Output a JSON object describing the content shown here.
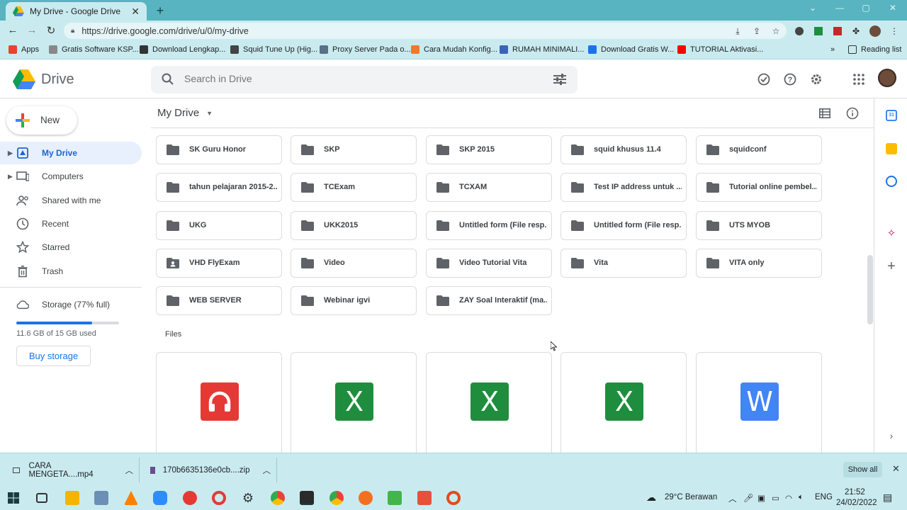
{
  "browser": {
    "tab_title": "My Drive - Google Drive",
    "url": "https://drive.google.com/drive/u/0/my-drive",
    "bookmarks": [
      {
        "label": "Apps",
        "color": "#e94235"
      },
      {
        "label": "Gratis Software KSP...",
        "color": "#888888"
      },
      {
        "label": "Download Lengkap...",
        "color": "#333333"
      },
      {
        "label": "Squid Tune Up (Hig...",
        "color": "#444444"
      },
      {
        "label": "Proxy Server Pada o...",
        "color": "#5b6f86"
      },
      {
        "label": "Cara Mudah Konfig...",
        "color": "#f0792b"
      },
      {
        "label": "RUMAH MINIMALI...",
        "color": "#3b64b8"
      },
      {
        "label": "Download Gratis W...",
        "color": "#1a73e8"
      },
      {
        "label": "TUTORIAL Aktivasi...",
        "color": "#ff0000"
      }
    ],
    "reading_list": "Reading list"
  },
  "drive": {
    "app_name": "Drive",
    "search_placeholder": "Search in Drive",
    "new_label": "New",
    "nav": [
      {
        "label": "My Drive",
        "active": true,
        "caret": true,
        "icon": "my-drive-icon"
      },
      {
        "label": "Computers",
        "active": false,
        "caret": true,
        "icon": "computers-icon"
      },
      {
        "label": "Shared with me",
        "active": false,
        "caret": false,
        "icon": "shared-icon"
      },
      {
        "label": "Recent",
        "active": false,
        "caret": false,
        "icon": "clock-icon"
      },
      {
        "label": "Starred",
        "active": false,
        "caret": false,
        "icon": "star-icon"
      },
      {
        "label": "Trash",
        "active": false,
        "caret": false,
        "icon": "trash-icon"
      }
    ],
    "storage_label": "Storage (77% full)",
    "storage_used": "11.6 GB of 15 GB used",
    "storage_fraction": 0.77,
    "buy_storage": "Buy storage",
    "breadcrumb": "My Drive",
    "folders": [
      {
        "name": "SK Guru Honor",
        "shared": false
      },
      {
        "name": "SKP",
        "shared": false
      },
      {
        "name": "SKP 2015",
        "shared": false
      },
      {
        "name": "squid khusus 11.4",
        "shared": false
      },
      {
        "name": "squidconf",
        "shared": false
      },
      {
        "name": "tahun pelajaran 2015-2...",
        "shared": false
      },
      {
        "name": "TCExam",
        "shared": false
      },
      {
        "name": "TCXAM",
        "shared": false
      },
      {
        "name": "Test IP address untuk ...",
        "shared": false
      },
      {
        "name": "Tutorial online pembel...",
        "shared": false
      },
      {
        "name": "UKG",
        "shared": false
      },
      {
        "name": "UKK2015",
        "shared": false
      },
      {
        "name": "Untitled form (File resp...",
        "shared": false
      },
      {
        "name": "Untitled form (File resp...",
        "shared": false
      },
      {
        "name": "UTS MYOB",
        "shared": false
      },
      {
        "name": "VHD FlyExam",
        "shared": true
      },
      {
        "name": "Video",
        "shared": false
      },
      {
        "name": "Video Tutorial Vita",
        "shared": false
      },
      {
        "name": "Vita",
        "shared": false
      },
      {
        "name": "VITA only",
        "shared": false
      },
      {
        "name": "WEB SERVER",
        "shared": false
      },
      {
        "name": "Webinar igvi",
        "shared": false
      },
      {
        "name": "ZAY Soal Interaktif (ma...",
        "shared": false
      }
    ],
    "files_label": "Files",
    "files": [
      {
        "type": "audio",
        "color": "#e53935",
        "glyph": "∩"
      },
      {
        "type": "excel",
        "color": "#1e8e3e",
        "glyph": "X"
      },
      {
        "type": "excel",
        "color": "#1e8e3e",
        "glyph": "X"
      },
      {
        "type": "excel",
        "color": "#1e8e3e",
        "glyph": "X"
      },
      {
        "type": "word",
        "color": "#4285f4",
        "glyph": "W"
      }
    ]
  },
  "downloads": {
    "items": [
      "CARA MENGETA....mp4",
      "170b6635136e0cb....zip"
    ],
    "show_all": "Show all"
  },
  "taskbar": {
    "weather": "29°C  Berawan",
    "lang": "ENG",
    "time": "21:52",
    "date": "24/02/2022"
  }
}
